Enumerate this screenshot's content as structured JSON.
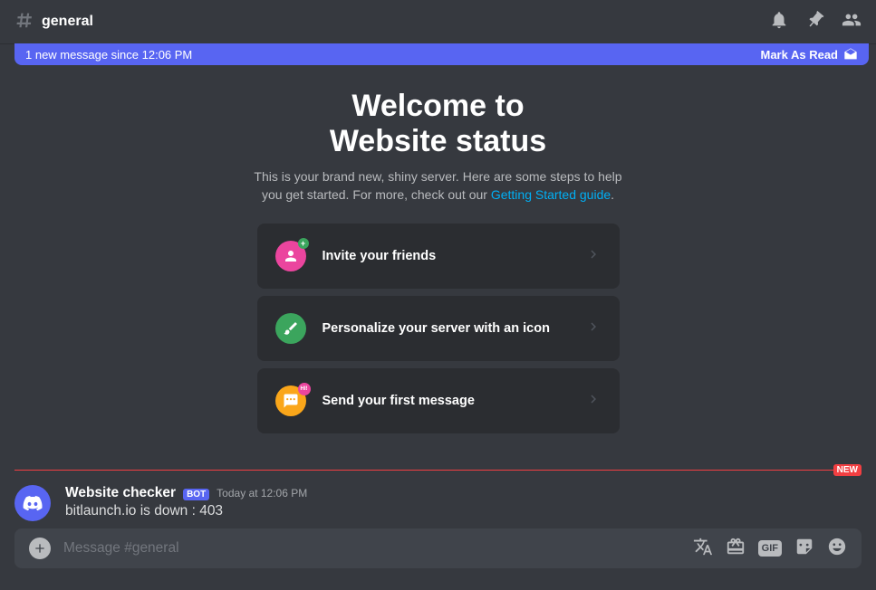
{
  "header": {
    "channel_name": "general"
  },
  "new_message_bar": {
    "text": "1 new message since 12:06 PM",
    "mark_read": "Mark As Read"
  },
  "welcome": {
    "title_line1": "Welcome to",
    "title_line2": "Website status",
    "desc_prefix": "This is your brand new, shiny server. Here are some steps to help you get started. For more, check out our ",
    "guide_link": "Getting Started guide",
    "desc_suffix": "."
  },
  "cards": [
    {
      "label": "Invite your friends",
      "icon": "invite"
    },
    {
      "label": "Personalize your server with an icon",
      "icon": "personalize"
    },
    {
      "label": "Send your first message",
      "icon": "message"
    }
  ],
  "divider": {
    "badge": "NEW"
  },
  "message": {
    "author": "Website checker",
    "bot_tag": "BOT",
    "timestamp": "Today at 12:06 PM",
    "content": "bitlaunch.io is down : 403"
  },
  "input": {
    "placeholder": "Message #general",
    "gif_label": "GIF"
  }
}
